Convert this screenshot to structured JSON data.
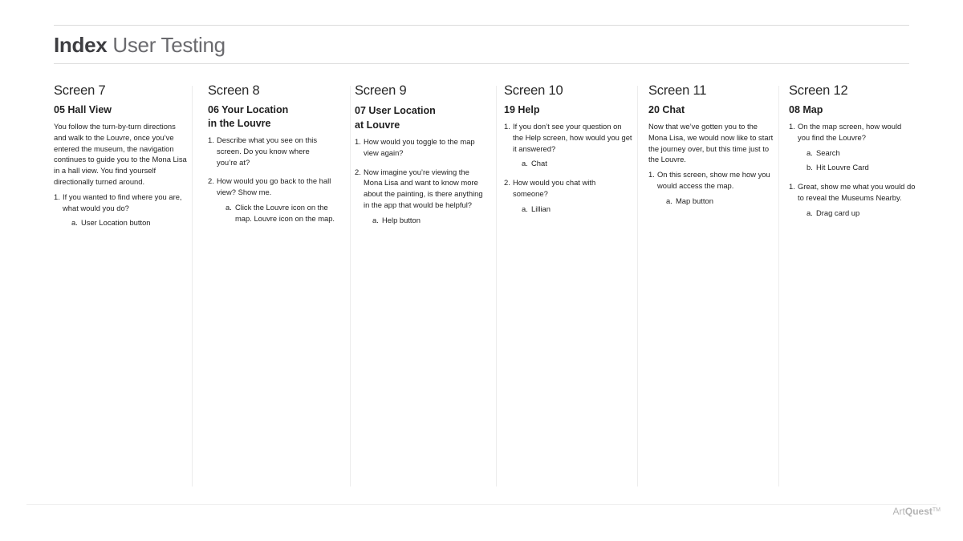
{
  "header": {
    "title_bold": "Index",
    "title_light": "User Testing"
  },
  "columns": [
    {
      "screen": "Screen 7",
      "title": "05 Hall View",
      "intro": "You follow the turn-by-turn directions and walk to the Louvre, once you’ve entered the museum, the navigation continues to guide you to the Mona Lisa in a hall view. You find yourself directionally turned around.",
      "questions": [
        {
          "num": "1.",
          "text": "If you wanted to find where you are, what would you do?",
          "answers": [
            {
              "letter": "a.",
              "text": "User Location button"
            }
          ]
        }
      ]
    },
    {
      "screen": "Screen 8",
      "title": "06 Your Location in the Louvre",
      "title_line1": "06 Your Location",
      "title_line2": "in the Louvre",
      "questions": [
        {
          "num": "1.",
          "text": "Describe what you see on this screen. Do you know where you’re at?",
          "answers": []
        },
        {
          "num": "2.",
          "text": "How would you go back to the hall view? Show me.",
          "answers": [
            {
              "letter": "a.",
              "text": "Click the Louvre icon on the map. Louvre icon on the map."
            }
          ]
        }
      ]
    },
    {
      "screen": "Screen 9",
      "title": "07 User Location at Louvre",
      "title_line1": "07 User Location",
      "title_line2": "at Louvre",
      "questions": [
        {
          "num": "1.",
          "text": "How would you toggle to the map view again?",
          "answers": []
        },
        {
          "num": "2.",
          "text": "Now imagine you’re viewing the Mona Lisa and want to know more about the painting, is there anything in the app that would be helpful?",
          "answers": [
            {
              "letter": "a.",
              "text": "Help button"
            }
          ]
        }
      ]
    },
    {
      "screen": "Screen 10",
      "title": "19 Help",
      "questions": [
        {
          "num": "1.",
          "text": "If you don’t see your question on the Help screen, how would you get it answered?",
          "answers": [
            {
              "letter": "a.",
              "text": "Chat"
            }
          ]
        },
        {
          "num": "2.",
          "text": "How would you chat with someone?",
          "answers": [
            {
              "letter": "a.",
              "text": "Lillian"
            }
          ]
        }
      ]
    },
    {
      "screen": "Screen 11",
      "title": "20 Chat",
      "intro": "Now that we’ve gotten you to the Mona Lisa, we would now like to start the journey over, but this time just to the Louvre.",
      "questions": [
        {
          "num": "1.",
          "text": "On this screen, show me how you would access the map.",
          "answers": [
            {
              "letter": "a.",
              "text": "Map button"
            }
          ]
        }
      ]
    },
    {
      "screen": "Screen 12",
      "title": "08 Map",
      "questions": [
        {
          "num": "1.",
          "text": "On the map screen, how would you find the Louvre?",
          "answers": [
            {
              "letter": "a.",
              "text": "Search"
            },
            {
              "letter": "b.",
              "text": "Hit Louvre Card"
            }
          ]
        },
        {
          "num": "1.",
          "text": "Great, show me what you would do to reveal the Museums Nearby.",
          "answers": [
            {
              "letter": "a.",
              "text": "Drag card up"
            }
          ]
        }
      ]
    }
  ],
  "footer": {
    "brand_light": "Art",
    "brand_bold": "Quest",
    "brand_tm": "TM"
  }
}
